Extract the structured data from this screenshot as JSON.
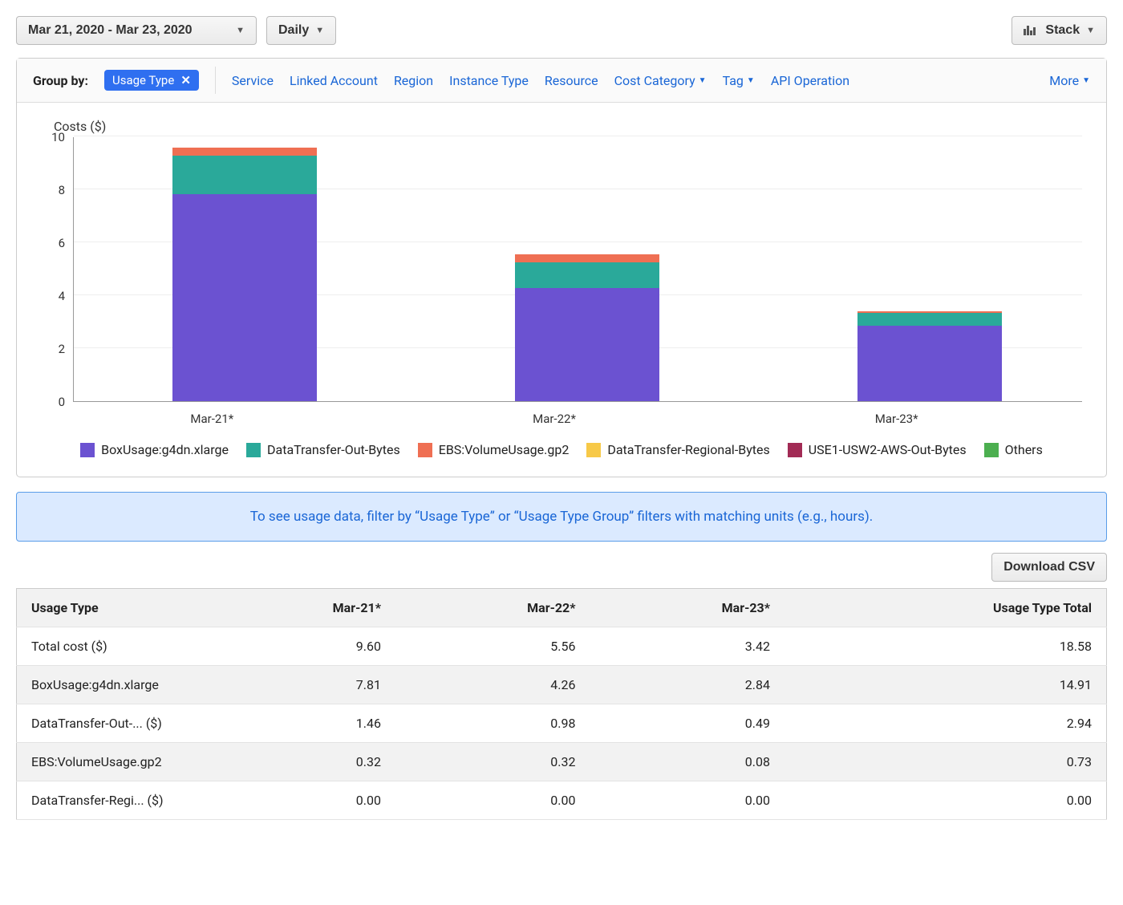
{
  "toolbar": {
    "date_range": "Mar 21, 2020 - Mar 23, 2020",
    "granularity": "Daily",
    "stack_label": "Stack"
  },
  "groupby": {
    "label": "Group by:",
    "active": "Usage Type",
    "options": [
      "Service",
      "Linked Account",
      "Region",
      "Instance Type",
      "Resource",
      "Cost Category",
      "Tag",
      "API Operation"
    ],
    "more_label": "More"
  },
  "chart_data": {
    "type": "bar",
    "title": "Costs ($)",
    "ylabel": "",
    "xlabel": "",
    "ylim": [
      0,
      10
    ],
    "yticks": [
      0,
      2,
      4,
      6,
      8,
      10
    ],
    "categories": [
      "Mar-21*",
      "Mar-22*",
      "Mar-23*"
    ],
    "series": [
      {
        "name": "BoxUsage:g4dn.xlarge",
        "color": "#6b52d1",
        "values": [
          7.81,
          4.26,
          2.84
        ]
      },
      {
        "name": "DataTransfer-Out-Bytes",
        "color": "#2aa99a",
        "values": [
          1.46,
          0.98,
          0.49
        ]
      },
      {
        "name": "EBS:VolumeUsage.gp2",
        "color": "#ef6f53",
        "values": [
          0.32,
          0.32,
          0.08
        ]
      },
      {
        "name": "DataTransfer-Regional-Bytes",
        "color": "#f7c948",
        "values": [
          0.0,
          0.0,
          0.0
        ]
      },
      {
        "name": "USE1-USW2-AWS-Out-Bytes",
        "color": "#a22b55",
        "values": [
          0.0,
          0.0,
          0.0
        ]
      },
      {
        "name": "Others",
        "color": "#4caf50",
        "values": [
          0.0,
          0.0,
          0.0
        ]
      }
    ]
  },
  "banner": "To see usage data, filter by “Usage Type” or “Usage Type Group” filters with matching units (e.g., hours).",
  "download_label": "Download CSV",
  "table": {
    "header": [
      "Usage Type",
      "Mar-21*",
      "Mar-22*",
      "Mar-23*",
      "Usage Type Total"
    ],
    "rows": [
      [
        "Total cost ($)",
        "9.60",
        "5.56",
        "3.42",
        "18.58"
      ],
      [
        "BoxUsage:g4dn.xlarge",
        "7.81",
        "4.26",
        "2.84",
        "14.91"
      ],
      [
        "DataTransfer-Out-... ($)",
        "1.46",
        "0.98",
        "0.49",
        "2.94"
      ],
      [
        "EBS:VolumeUsage.gp2",
        "0.32",
        "0.32",
        "0.08",
        "0.73"
      ],
      [
        "DataTransfer-Regi... ($)",
        "0.00",
        "0.00",
        "0.00",
        "0.00"
      ]
    ]
  }
}
